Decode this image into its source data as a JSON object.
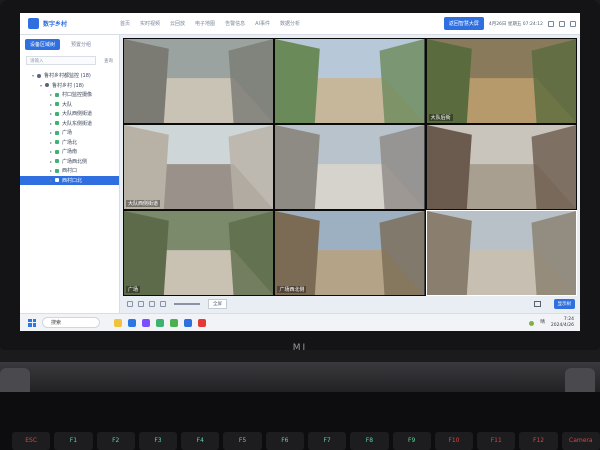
{
  "app": {
    "logo_text": "数字乡村",
    "nav_tabs": [
      "首页",
      "实时视频",
      "云回放",
      "电子地图",
      "告警信息",
      "AI事件",
      "数据分析"
    ],
    "bigscreen_button": "返回智慧大屏",
    "clock": "4月26日 星期五 07:24:12"
  },
  "sidebar": {
    "tabs": [
      "设备区域树",
      "预置分组"
    ],
    "search_placeholder": "请输入",
    "search_button": "查询",
    "tree": [
      {
        "label": "鲁村乡村都监控 (18)",
        "level": 1,
        "type": "region"
      },
      {
        "label": "鲁村乡村 (18)",
        "level": 2,
        "type": "region"
      },
      {
        "label": "村口监控摄像",
        "level": 3,
        "type": "camera"
      },
      {
        "label": "大队",
        "level": 3,
        "type": "camera"
      },
      {
        "label": "大队西侧街道",
        "level": 3,
        "type": "camera"
      },
      {
        "label": "大队东侧街道",
        "level": 3,
        "type": "camera"
      },
      {
        "label": "广场",
        "level": 3,
        "type": "camera"
      },
      {
        "label": "广场北",
        "level": 3,
        "type": "camera"
      },
      {
        "label": "广场南",
        "level": 3,
        "type": "camera"
      },
      {
        "label": "广场西北侧",
        "level": 3,
        "type": "camera"
      },
      {
        "label": "西村口",
        "level": 3,
        "type": "camera"
      },
      {
        "label": "西村口北",
        "level": 3,
        "type": "camera",
        "selected": true
      }
    ]
  },
  "video_cells": [
    {
      "label": ""
    },
    {
      "label": ""
    },
    {
      "label": "大队后街"
    },
    {
      "label": "大队西侧街道"
    },
    {
      "label": ""
    },
    {
      "label": ""
    },
    {
      "label": "广场"
    },
    {
      "label": "广场西北侧"
    },
    {
      "label": ""
    }
  ],
  "bottom_bar": {
    "zoom_button": "全屏",
    "show_tree_button": "显示树"
  },
  "taskbar": {
    "search_text": "搜索",
    "time": "7:24",
    "date": "2024/4/26",
    "weather": "晴"
  },
  "laptop": {
    "brand": "MI",
    "fkeys": [
      "ESC",
      "F1",
      "F2",
      "F3",
      "F4",
      "F5",
      "F6",
      "F7",
      "F8",
      "F9",
      "F10",
      "F11",
      "F12",
      "Camera"
    ]
  },
  "colors": {
    "accent": "#2f6fe0",
    "camera_online": "#3cb371"
  }
}
